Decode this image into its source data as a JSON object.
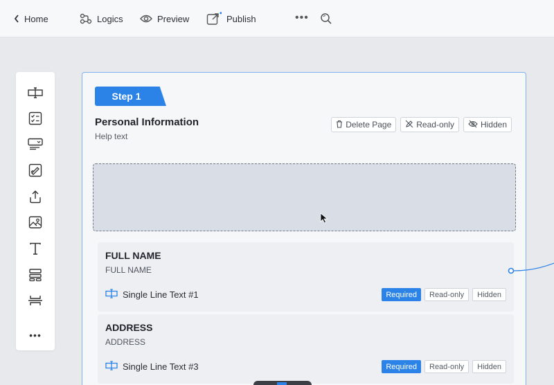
{
  "topbar": {
    "home_label": "Home",
    "logics_label": "Logics",
    "preview_label": "Preview",
    "publish_label": "Publish",
    "more_label": "•••"
  },
  "toolbox": {
    "icons": [
      "text-field-icon",
      "checklist-icon",
      "select-dropdown-icon",
      "signature-icon",
      "upload-icon",
      "image-icon",
      "text-icon",
      "layout-icon",
      "section-break-icon"
    ],
    "more_label": "•••"
  },
  "page": {
    "step_label": "Step 1",
    "title": "Personal Information",
    "help_text": "Help text",
    "actions": {
      "delete_label": "Delete Page",
      "readonly_label": "Read-only",
      "hidden_label": "Hidden"
    }
  },
  "fields": [
    {
      "title": "FULL NAME",
      "subtitle": "FULL NAME",
      "type_label": "Single Line Text #1",
      "required_label": "Required",
      "readonly_label": "Read-only",
      "hidden_label": "Hidden"
    },
    {
      "title": "ADDRESS",
      "subtitle": "ADDRESS",
      "type_label": "Single Line Text #3",
      "required_label": "Required",
      "readonly_label": "Read-only",
      "hidden_label": "Hidden"
    }
  ],
  "colors": {
    "accent": "#2b83e8",
    "page_border": "#7db2ef"
  }
}
